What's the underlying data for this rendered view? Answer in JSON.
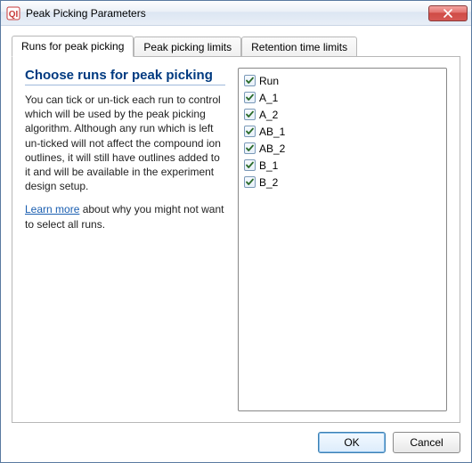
{
  "window": {
    "title": "Peak Picking Parameters"
  },
  "tabs": [
    {
      "label": "Runs for peak picking",
      "active": true
    },
    {
      "label": "Peak picking limits",
      "active": false
    },
    {
      "label": "Retention time limits",
      "active": false
    }
  ],
  "panel": {
    "heading": "Choose runs for peak picking",
    "paragraph": "You can tick or un-tick each run to control which will be used by the peak picking algorithm. Although any run which is left un-ticked will not affect the compound ion outlines, it will still have outlines added to it and will be available in the experiment design setup.",
    "learn_more_label": "Learn more",
    "learn_more_rest": " about why you might not want to select all runs.",
    "runs": [
      {
        "label": "Run",
        "checked": true
      },
      {
        "label": "A_1",
        "checked": true
      },
      {
        "label": "A_2",
        "checked": true
      },
      {
        "label": "AB_1",
        "checked": true
      },
      {
        "label": "AB_2",
        "checked": true
      },
      {
        "label": "B_1",
        "checked": true
      },
      {
        "label": "B_2",
        "checked": true
      }
    ]
  },
  "buttons": {
    "ok": "OK",
    "cancel": "Cancel"
  },
  "colors": {
    "heading": "#003a80",
    "link": "#1a5eb0"
  }
}
